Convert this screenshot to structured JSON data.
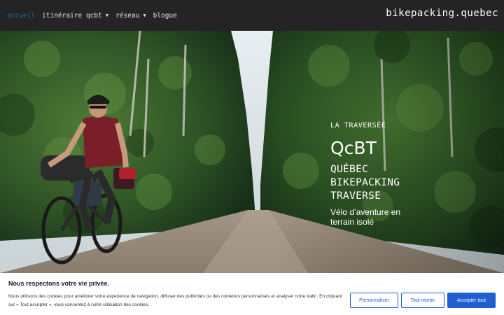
{
  "nav": {
    "items": [
      {
        "label": "accueil",
        "active": true,
        "dropdown": false
      },
      {
        "label": "itinéraire qcbt",
        "active": false,
        "dropdown": true
      },
      {
        "label": "réseau",
        "active": false,
        "dropdown": true
      },
      {
        "label": "blogue",
        "active": false,
        "dropdown": false
      }
    ],
    "caret_icon": "chevron-down-icon",
    "brand": "bikepacking.quebec"
  },
  "hero": {
    "kicker": "LA TRAVERSÉE",
    "title": "QcBT",
    "subtitle_lines": [
      "QUÉBEC",
      "BIKEPACKING",
      "TRAVERSE"
    ],
    "tagline": "Vélo d’aventure en terrain isolé",
    "image": "cyclist-on-forest-gravel-road"
  },
  "cookie": {
    "title": "Nous respectons votre vie privée.",
    "text": "Nous utilisons des cookies pour améliorer votre expérience de navigation, diffuser des publicités ou des contenus personnalisés et analyser notre trafic. En cliquant sur « Tout accepter », vous consentez à notre utilisation des cookies.",
    "buttons": {
      "customize": "Personnaliser",
      "reject": "Tout rejeter",
      "accept": "Accepter tout"
    }
  },
  "colors": {
    "nav_bg": "#242424",
    "nav_active": "#1f6fb0",
    "accent": "#1f5fd1"
  }
}
